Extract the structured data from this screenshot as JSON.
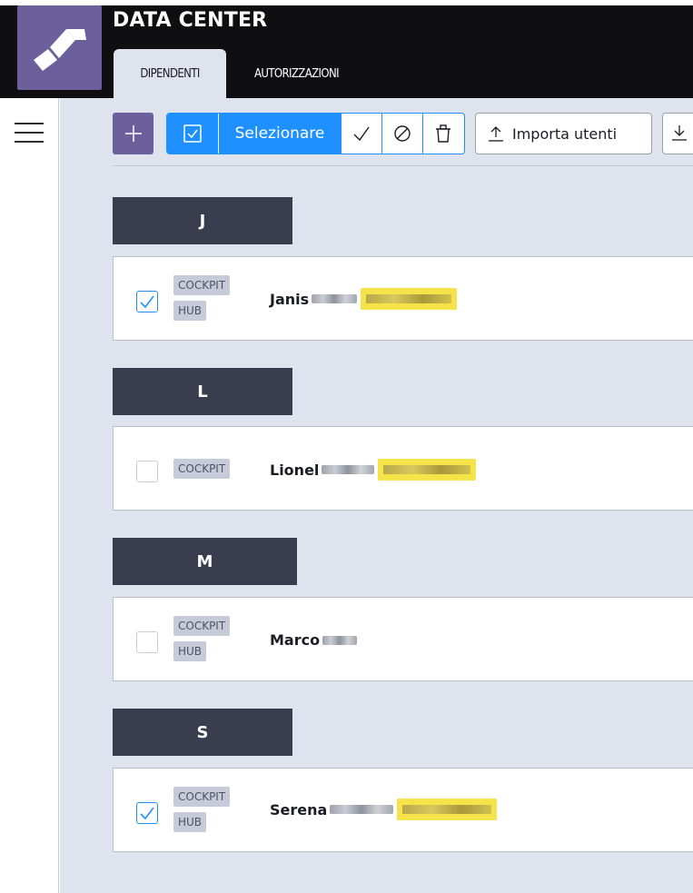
{
  "app": {
    "title": "DATA CENTER"
  },
  "tabs": [
    {
      "label": "DIPENDENTI",
      "active": true
    },
    {
      "label": "AUTORIZZAZIONI",
      "active": false
    }
  ],
  "toolbar": {
    "select_label": "Selezionare",
    "import_label": "Importa utenti"
  },
  "groups": [
    {
      "letter": "J",
      "users": [
        {
          "first_name": "Janis",
          "checked": true,
          "badges": [
            "COCKPIT",
            "HUB"
          ]
        }
      ]
    },
    {
      "letter": "L",
      "users": [
        {
          "first_name": "Lionel",
          "checked": false,
          "badges": [
            "COCKPIT"
          ]
        }
      ]
    },
    {
      "letter": "M",
      "users": [
        {
          "first_name": "Marco",
          "checked": false,
          "badges": [
            "COCKPIT",
            "HUB"
          ]
        }
      ]
    },
    {
      "letter": "S",
      "users": [
        {
          "first_name": "Serena",
          "checked": true,
          "badges": [
            "COCKPIT",
            "HUB"
          ]
        }
      ]
    }
  ],
  "colors": {
    "accent_purple": "#6b5f9c",
    "accent_blue": "#1e90ff",
    "group_header": "#3a3d4e",
    "background": "#dfe3ee",
    "highlight": "#f6e34a"
  },
  "icons": [
    "logo-icon",
    "menu-icon",
    "plus-icon",
    "checkbox-icon",
    "check-icon",
    "ban-icon",
    "trash-icon",
    "upload-icon",
    "download-icon"
  ]
}
